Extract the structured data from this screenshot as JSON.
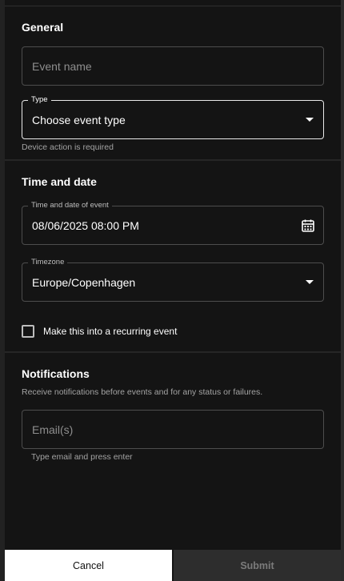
{
  "general": {
    "title": "General",
    "event_name": {
      "placeholder": "Event name",
      "value": ""
    },
    "type": {
      "legend": "Type",
      "value": "Choose event type",
      "helper": "Device action is required"
    }
  },
  "time_and_date": {
    "title": "Time and date",
    "datetime": {
      "legend": "Time and date of event",
      "value": "08/06/2025 08:00 PM",
      "icon": "calendar-icon"
    },
    "timezone": {
      "legend": "Timezone",
      "value": "Europe/Copenhagen"
    },
    "recurring": {
      "label": "Make this into a recurring event",
      "checked": false
    }
  },
  "notifications": {
    "title": "Notifications",
    "description": "Receive notifications before events and for any status or failures.",
    "email": {
      "placeholder": "Email(s)",
      "helper": "Type email and press enter"
    }
  },
  "actions": {
    "cancel_label": "Cancel",
    "submit_label": "Submit"
  },
  "colors": {
    "background": "#141414",
    "border": "#4d4d4d",
    "text": "#ffffff",
    "muted": "#a3a3a3",
    "submit_bg": "#2d2d2d"
  }
}
